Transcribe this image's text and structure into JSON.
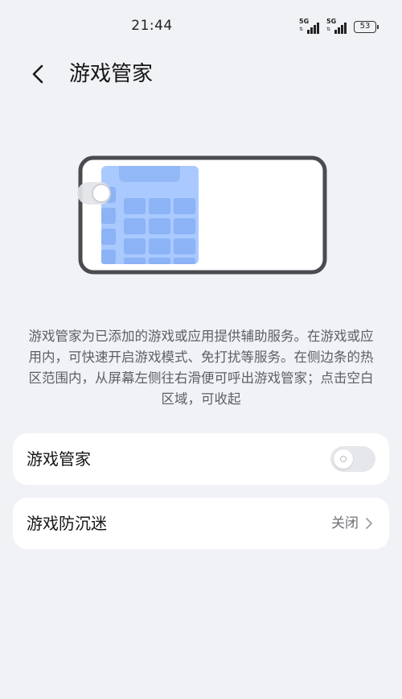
{
  "status_bar": {
    "time": "21:44",
    "signal1_label": "5G",
    "signal2_label": "5G",
    "battery": "53"
  },
  "header": {
    "title": "游戏管家",
    "back_icon": "chevron-left-icon"
  },
  "description": "游戏管家为已添加的游戏或应用提供辅助服务。在游戏或应用内，可快速开启游戏模式、免打扰等服务。在侧边条的热区范围内，从屏幕左侧往右滑便可呼出游戏管家；点击空白区域，可收起",
  "settings": [
    {
      "label": "游戏管家",
      "control": "toggle",
      "enabled": false
    },
    {
      "label": "游戏防沉迷",
      "value": "关闭",
      "control": "chevron-right-icon"
    }
  ],
  "colors": {
    "background": "#f1f2f6",
    "card": "#ffffff",
    "illustration_blue": "#a9c9ff",
    "phone_frame": "#4a4b50"
  }
}
